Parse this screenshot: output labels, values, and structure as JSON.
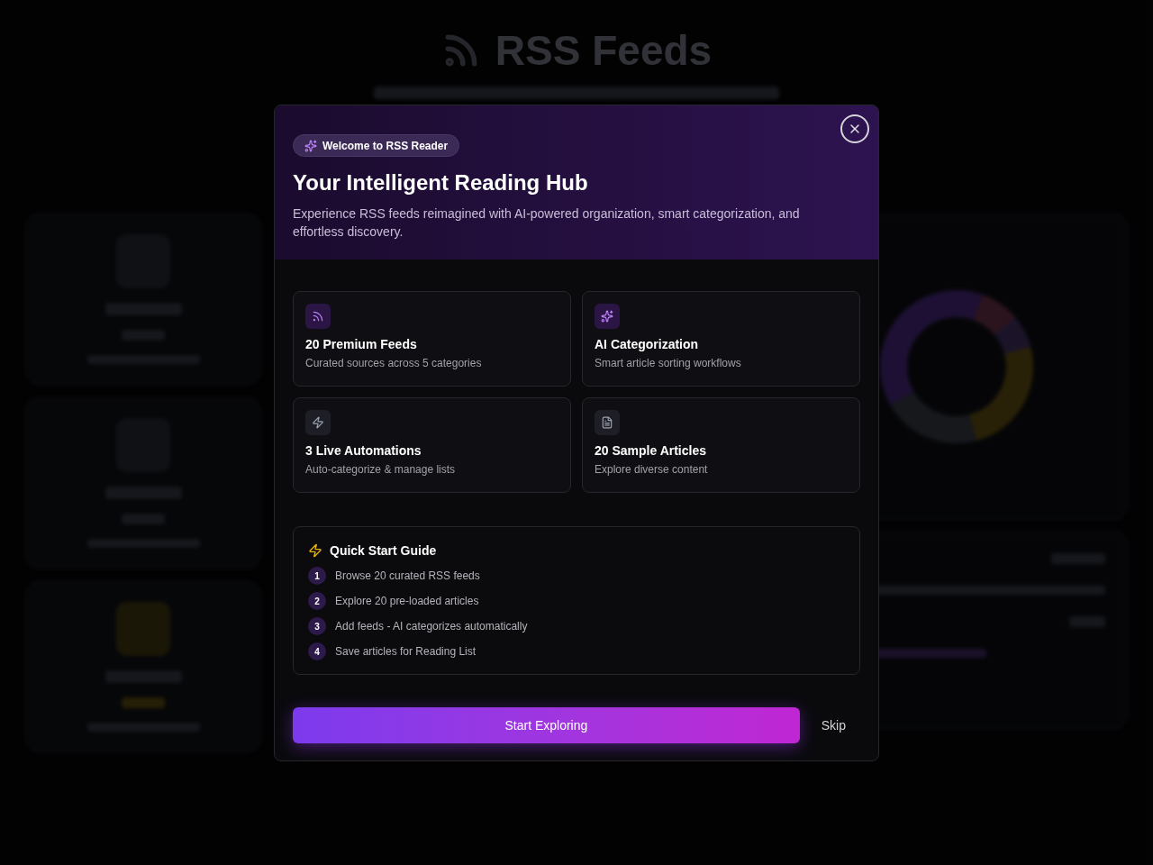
{
  "background": {
    "title": "RSS Feeds"
  },
  "dialog": {
    "badge": "Welcome to RSS Reader",
    "title": "Your Intelligent Reading Hub",
    "description": "Experience RSS feeds reimagined with AI-powered organization, smart categorization, and effortless discovery.",
    "features": [
      {
        "kind": "feeds",
        "title": "20 Premium Feeds",
        "subtitle": "Curated sources across 5 categories"
      },
      {
        "kind": "ai",
        "title": "AI Categorization",
        "subtitle": "Smart article sorting workflows"
      },
      {
        "kind": "automation",
        "title": "3 Live Automations",
        "subtitle": "Auto-categorize & manage lists"
      },
      {
        "kind": "articles",
        "title": "20 Sample Articles",
        "subtitle": "Explore diverse content"
      }
    ],
    "guide": {
      "title": "Quick Start Guide",
      "steps": [
        {
          "number": "1",
          "text": "Browse 20 curated RSS feeds"
        },
        {
          "number": "2",
          "text": "Explore 20 pre-loaded articles"
        },
        {
          "number": "3",
          "text": "Add feeds - AI categorizes automatically"
        },
        {
          "number": "4",
          "text": "Save articles for Reading List"
        }
      ]
    },
    "primary_button": "Start Exploring",
    "secondary_button": "Skip"
  }
}
